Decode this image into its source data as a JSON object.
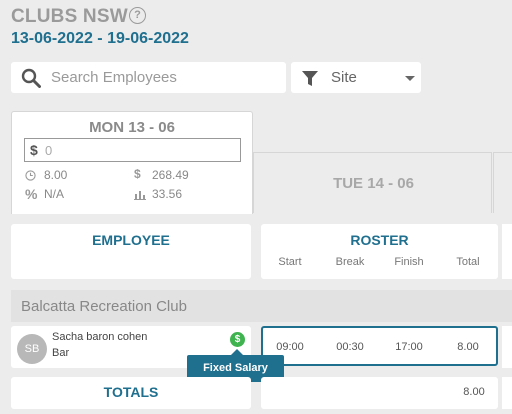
{
  "header": {
    "title": "CLUBS NSW",
    "help_icon": "?",
    "date_range": "13-06-2022 - 19-06-2022"
  },
  "search": {
    "placeholder": "Search Employees",
    "icon": "search-icon"
  },
  "site_filter": {
    "label": "Site",
    "icon": "filter-icon"
  },
  "days": [
    {
      "label": "MON 13 - 06",
      "currency": "$",
      "cost_value": "0",
      "hours": "8.00",
      "cost": "268.49",
      "percent": "N/A",
      "chart_value": "33.56"
    },
    {
      "label": "TUE 14 - 06"
    }
  ],
  "table": {
    "employee_header": "EMPLOYEE",
    "roster_header": "ROSTER",
    "columns": [
      "Start",
      "Break",
      "Finish",
      "Total"
    ]
  },
  "group": {
    "name": "Balcatta Recreation Club"
  },
  "employee": {
    "initials": "SB",
    "name": "Sacha baron cohen",
    "role": "Bar",
    "salary_icon": "$",
    "tooltip": "Fixed Salary",
    "shift": {
      "start": "09:00",
      "break": "00:30",
      "finish": "17:00",
      "total": "8.00"
    }
  },
  "totals": {
    "label": "TOTALS",
    "value": "8.00"
  },
  "colors": {
    "accent": "#1f6f8f",
    "salary_badge": "#3fb34f"
  }
}
